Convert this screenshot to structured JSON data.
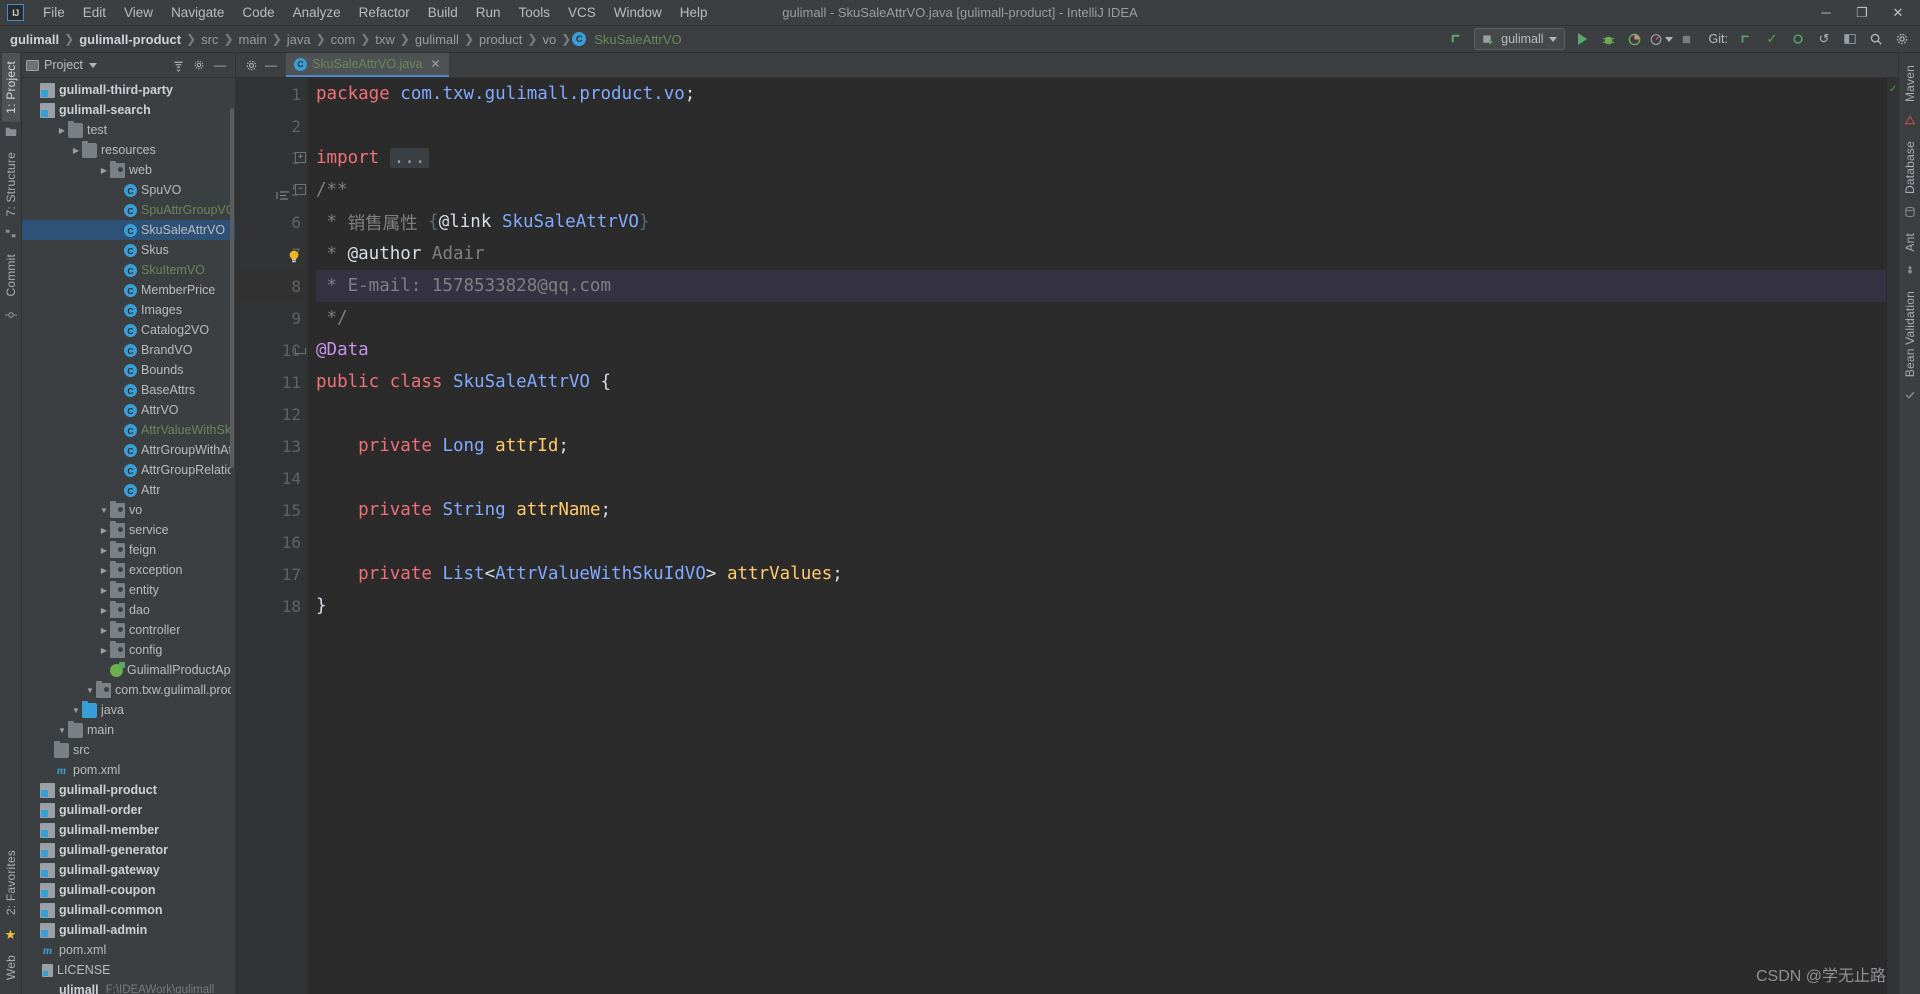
{
  "window": {
    "title": "gulimall - SkuSaleAttrVO.java [gulimall-product] - IntelliJ IDEA",
    "logo": "IJ",
    "minimize": "─",
    "maximize": "❐",
    "close": "✕"
  },
  "menu": [
    {
      "label": "File"
    },
    {
      "label": "Edit"
    },
    {
      "label": "View"
    },
    {
      "label": "Navigate"
    },
    {
      "label": "Code"
    },
    {
      "label": "Analyze"
    },
    {
      "label": "Refactor"
    },
    {
      "label": "Build"
    },
    {
      "label": "Run"
    },
    {
      "label": "Tools"
    },
    {
      "label": "VCS"
    },
    {
      "label": "Window"
    },
    {
      "label": "Help"
    }
  ],
  "breadcrumb": [
    {
      "label": "gulimall",
      "style": "bold"
    },
    {
      "label": "gulimall-product",
      "style": "bold"
    },
    {
      "label": "src",
      "style": "dim"
    },
    {
      "label": "main",
      "style": "dim"
    },
    {
      "label": "java",
      "style": "dim"
    },
    {
      "label": "com",
      "style": "dim"
    },
    {
      "label": "txw",
      "style": "dim"
    },
    {
      "label": "gulimall",
      "style": "dim"
    },
    {
      "label": "product",
      "style": "dim"
    },
    {
      "label": "vo",
      "style": "dim"
    },
    {
      "label": "SkuSaleAttrVO",
      "style": "green"
    }
  ],
  "toolbar": {
    "run_config": "gulimall",
    "git_label": "Git:",
    "update_arrow": "↖",
    "run_icon": "run-icon",
    "debug_icon": "debug-icon",
    "coverage_icon": "coverage-icon",
    "profile_icon": "profile-icon",
    "search_icon": "⌕",
    "settings_icon": "⚙",
    "check_icon": "✓",
    "rollback_icon": "↺"
  },
  "left_tabs": [
    {
      "label": "1: Project",
      "active": true
    },
    {
      "label": "7: Structure",
      "active": false
    },
    {
      "label": "Commit",
      "active": false
    }
  ],
  "left_tabs_bottom": [
    {
      "label": "2: Favorites"
    },
    {
      "label": "Web"
    }
  ],
  "right_tabs": [
    {
      "label": "Maven"
    },
    {
      "label": "Database"
    },
    {
      "label": "Ant"
    },
    {
      "label": "Bean Validation"
    }
  ],
  "project_panel": {
    "title": "Project",
    "collapse_icon": "≡",
    "settings_icon": "⚙",
    "minimize_icon": "─"
  },
  "tree": [
    {
      "indent": 0,
      "arrow": "",
      "icon": "none",
      "label": "ulimall",
      "bold": true,
      "path": "F:\\IDEAWork\\gulimall"
    },
    {
      "indent": 0,
      "arrow": "",
      "icon": "file",
      "label": "LICENSE",
      "bold": false,
      "path": ""
    },
    {
      "indent": 0,
      "arrow": "",
      "icon": "maven",
      "label": "pom.xml",
      "bold": false,
      "path": ""
    },
    {
      "indent": 0,
      "arrow": "",
      "icon": "module",
      "label": "gulimall-admin",
      "bold": true,
      "path": ""
    },
    {
      "indent": 0,
      "arrow": "",
      "icon": "module",
      "label": "gulimall-common",
      "bold": true,
      "path": ""
    },
    {
      "indent": 0,
      "arrow": "",
      "icon": "module",
      "label": "gulimall-coupon",
      "bold": true,
      "path": ""
    },
    {
      "indent": 0,
      "arrow": "",
      "icon": "module",
      "label": "gulimall-gateway",
      "bold": true,
      "path": ""
    },
    {
      "indent": 0,
      "arrow": "",
      "icon": "module",
      "label": "gulimall-generator",
      "bold": true,
      "path": ""
    },
    {
      "indent": 0,
      "arrow": "",
      "icon": "module",
      "label": "gulimall-member",
      "bold": true,
      "path": ""
    },
    {
      "indent": 0,
      "arrow": "",
      "icon": "module",
      "label": "gulimall-order",
      "bold": true,
      "path": ""
    },
    {
      "indent": 0,
      "arrow": "",
      "icon": "module",
      "label": "gulimall-product",
      "bold": true,
      "path": ""
    },
    {
      "indent": 1,
      "arrow": "",
      "icon": "maven",
      "label": "pom.xml",
      "bold": false,
      "path": ""
    },
    {
      "indent": 1,
      "arrow": "",
      "icon": "folder",
      "label": "src",
      "bold": false,
      "path": ""
    },
    {
      "indent": 2,
      "arrow": "▼",
      "icon": "folder",
      "label": "main",
      "bold": false,
      "path": ""
    },
    {
      "indent": 3,
      "arrow": "▼",
      "icon": "folder-blue",
      "label": "java",
      "bold": false,
      "path": ""
    },
    {
      "indent": 4,
      "arrow": "▼",
      "icon": "pkg",
      "label": "com.txw.gulimall.product",
      "bold": false,
      "path": ""
    },
    {
      "indent": 5,
      "arrow": "",
      "icon": "spring",
      "label": "GulimallProductApplication",
      "bold": false,
      "path": ""
    },
    {
      "indent": 5,
      "arrow": "▶",
      "icon": "pkg",
      "label": "config",
      "bold": false,
      "path": ""
    },
    {
      "indent": 5,
      "arrow": "▶",
      "icon": "pkg",
      "label": "controller",
      "bold": false,
      "path": ""
    },
    {
      "indent": 5,
      "arrow": "▶",
      "icon": "pkg",
      "label": "dao",
      "bold": false,
      "path": ""
    },
    {
      "indent": 5,
      "arrow": "▶",
      "icon": "pkg",
      "label": "entity",
      "bold": false,
      "path": ""
    },
    {
      "indent": 5,
      "arrow": "▶",
      "icon": "pkg",
      "label": "exception",
      "bold": false,
      "path": ""
    },
    {
      "indent": 5,
      "arrow": "▶",
      "icon": "pkg",
      "label": "feign",
      "bold": false,
      "path": ""
    },
    {
      "indent": 5,
      "arrow": "▶",
      "icon": "pkg",
      "label": "service",
      "bold": false,
      "path": ""
    },
    {
      "indent": 5,
      "arrow": "▼",
      "icon": "pkg",
      "label": "vo",
      "bold": false,
      "path": ""
    },
    {
      "indent": 6,
      "arrow": "",
      "icon": "class",
      "label": "Attr",
      "bold": false,
      "path": ""
    },
    {
      "indent": 6,
      "arrow": "",
      "icon": "class",
      "label": "AttrGroupRelationVO",
      "bold": false,
      "path": ""
    },
    {
      "indent": 6,
      "arrow": "",
      "icon": "class",
      "label": "AttrGroupWithAttrsVO",
      "bold": false,
      "path": ""
    },
    {
      "indent": 6,
      "arrow": "",
      "icon": "class",
      "label": "AttrValueWithSkuIdVO",
      "bold": false,
      "path": "",
      "green": true
    },
    {
      "indent": 6,
      "arrow": "",
      "icon": "class",
      "label": "AttrVO",
      "bold": false,
      "path": ""
    },
    {
      "indent": 6,
      "arrow": "",
      "icon": "class",
      "label": "BaseAttrs",
      "bold": false,
      "path": ""
    },
    {
      "indent": 6,
      "arrow": "",
      "icon": "class",
      "label": "Bounds",
      "bold": false,
      "path": ""
    },
    {
      "indent": 6,
      "arrow": "",
      "icon": "class",
      "label": "BrandVO",
      "bold": false,
      "path": ""
    },
    {
      "indent": 6,
      "arrow": "",
      "icon": "class",
      "label": "Catalog2VO",
      "bold": false,
      "path": ""
    },
    {
      "indent": 6,
      "arrow": "",
      "icon": "class",
      "label": "Images",
      "bold": false,
      "path": ""
    },
    {
      "indent": 6,
      "arrow": "",
      "icon": "class",
      "label": "MemberPrice",
      "bold": false,
      "path": ""
    },
    {
      "indent": 6,
      "arrow": "",
      "icon": "class",
      "label": "SkuItemVO",
      "bold": false,
      "path": "",
      "green": true
    },
    {
      "indent": 6,
      "arrow": "",
      "icon": "class",
      "label": "Skus",
      "bold": false,
      "path": ""
    },
    {
      "indent": 6,
      "arrow": "",
      "icon": "class",
      "label": "SkuSaleAttrVO",
      "bold": false,
      "path": "",
      "selected": true
    },
    {
      "indent": 6,
      "arrow": "",
      "icon": "class",
      "label": "SpuAttrGroupVO",
      "bold": false,
      "path": "",
      "green": true
    },
    {
      "indent": 6,
      "arrow": "",
      "icon": "class",
      "label": "SpuVO",
      "bold": false,
      "path": ""
    },
    {
      "indent": 5,
      "arrow": "▶",
      "icon": "pkg",
      "label": "web",
      "bold": false,
      "path": ""
    },
    {
      "indent": 3,
      "arrow": "▶",
      "icon": "folder",
      "label": "resources",
      "bold": false,
      "path": ""
    },
    {
      "indent": 2,
      "arrow": "▶",
      "icon": "folder",
      "label": "test",
      "bold": false,
      "path": ""
    },
    {
      "indent": 0,
      "arrow": "",
      "icon": "module",
      "label": "gulimall-search",
      "bold": true,
      "path": ""
    },
    {
      "indent": 0,
      "arrow": "",
      "icon": "module",
      "label": "gulimall-third-party",
      "bold": true,
      "path": ""
    }
  ],
  "editor": {
    "tab": {
      "filename": "SkuSaleAttrVO.java",
      "icon_letter": "C",
      "close": "✕"
    },
    "lines": [
      {
        "n": 1,
        "tokens": [
          {
            "t": "package ",
            "c": "kw2"
          },
          {
            "t": "com.txw.gulimall.product.vo",
            "c": "pkgname"
          },
          {
            "t": ";",
            "c": "white"
          }
        ]
      },
      {
        "n": 2,
        "tokens": []
      },
      {
        "n": 3,
        "tokens": [
          {
            "t": "import ",
            "c": "kw2"
          },
          {
            "t": "...",
            "c": "fold-ph"
          }
        ]
      },
      {
        "n": 5,
        "tokens": [
          {
            "t": "/**",
            "c": "cmt"
          }
        ]
      },
      {
        "n": 6,
        "tokens": [
          {
            "t": " * ",
            "c": "cmt"
          },
          {
            "t": "销售属性 ",
            "c": "cmt"
          },
          {
            "t": "{",
            "c": "link-tag"
          },
          {
            "t": "@link",
            "c": "white"
          },
          {
            "t": " ",
            "c": "cmt"
          },
          {
            "t": "SkuSaleAttrVO",
            "c": "type"
          },
          {
            "t": "}",
            "c": "link-tag"
          }
        ]
      },
      {
        "n": 7,
        "tokens": [
          {
            "t": " * ",
            "c": "cmt"
          },
          {
            "t": "@author",
            "c": "white"
          },
          {
            "t": " Adair",
            "c": "cmt"
          }
        ]
      },
      {
        "n": 8,
        "tokens": [
          {
            "t": " * E-mail: 1578533828@qq.com",
            "c": "cmt"
          }
        ],
        "highlight": true
      },
      {
        "n": 9,
        "tokens": [
          {
            "t": " */",
            "c": "cmt"
          }
        ]
      },
      {
        "n": 10,
        "tokens": [
          {
            "t": "@Data",
            "c": "ann"
          }
        ]
      },
      {
        "n": 11,
        "tokens": [
          {
            "t": "public class ",
            "c": "kw2"
          },
          {
            "t": "SkuSaleAttrVO",
            "c": "type"
          },
          {
            "t": " {",
            "c": "white"
          }
        ]
      },
      {
        "n": 12,
        "tokens": []
      },
      {
        "n": 13,
        "tokens": [
          {
            "t": "    private ",
            "c": "kw2"
          },
          {
            "t": "Long",
            "c": "type"
          },
          {
            "t": " ",
            "c": "white"
          },
          {
            "t": "attrId",
            "c": "field"
          },
          {
            "t": ";",
            "c": "white"
          }
        ]
      },
      {
        "n": 14,
        "tokens": []
      },
      {
        "n": 15,
        "tokens": [
          {
            "t": "    private ",
            "c": "kw2"
          },
          {
            "t": "String",
            "c": "type"
          },
          {
            "t": " ",
            "c": "white"
          },
          {
            "t": "attrName",
            "c": "field"
          },
          {
            "t": ";",
            "c": "white"
          }
        ]
      },
      {
        "n": 16,
        "tokens": []
      },
      {
        "n": 17,
        "tokens": [
          {
            "t": "    private ",
            "c": "kw2"
          },
          {
            "t": "List",
            "c": "type"
          },
          {
            "t": "<",
            "c": "white"
          },
          {
            "t": "AttrValueWithSkuIdVO",
            "c": "type"
          },
          {
            "t": "> ",
            "c": "white"
          },
          {
            "t": "attrValues",
            "c": "field"
          },
          {
            "t": ";",
            "c": "white"
          }
        ]
      },
      {
        "n": 18,
        "tokens": [
          {
            "t": "}",
            "c": "white"
          }
        ]
      }
    ]
  },
  "watermark": "CSDN @学无止路"
}
